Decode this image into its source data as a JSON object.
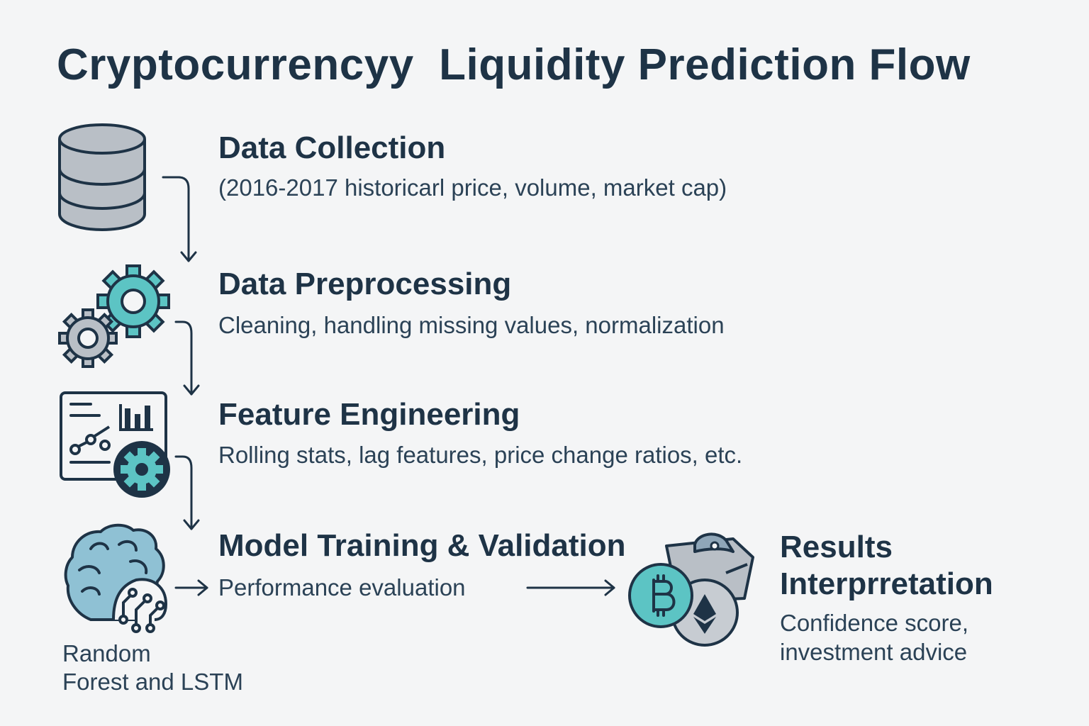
{
  "title": "Cryptocurrencyy  Liquidity Prediction Flow",
  "steps": [
    {
      "title": "Data Collection",
      "description": "(2016-2017 historicarl price, volume, market cap)",
      "icon": "database-icon"
    },
    {
      "title": "Data Preprocessing",
      "description": "Cleaning, handling missing values, normalization",
      "icon": "gears-icon"
    },
    {
      "title": "Feature Engineering",
      "description": "Rolling stats, lag features, price change ratios, etc.",
      "icon": "dashboard-gear-icon"
    },
    {
      "title": "Model Training & Validation",
      "description": "Performance evaluation",
      "icon": "brain-circuit-icon",
      "note_line1": "Random",
      "note_line2": "Forest and LSTM"
    },
    {
      "title_line1": "Results",
      "title_line2": "Interprretation",
      "description_line1": "Confidence score,",
      "description_line2": "investment advice",
      "icon": "crypto-coins-wallet-icon"
    }
  ],
  "colors": {
    "background": "#f4f5f6",
    "text_dark": "#1e3346",
    "teal": "#5cc4c4",
    "gray_icon": "#b9bfc6",
    "blue_icon": "#8fc1d4"
  }
}
